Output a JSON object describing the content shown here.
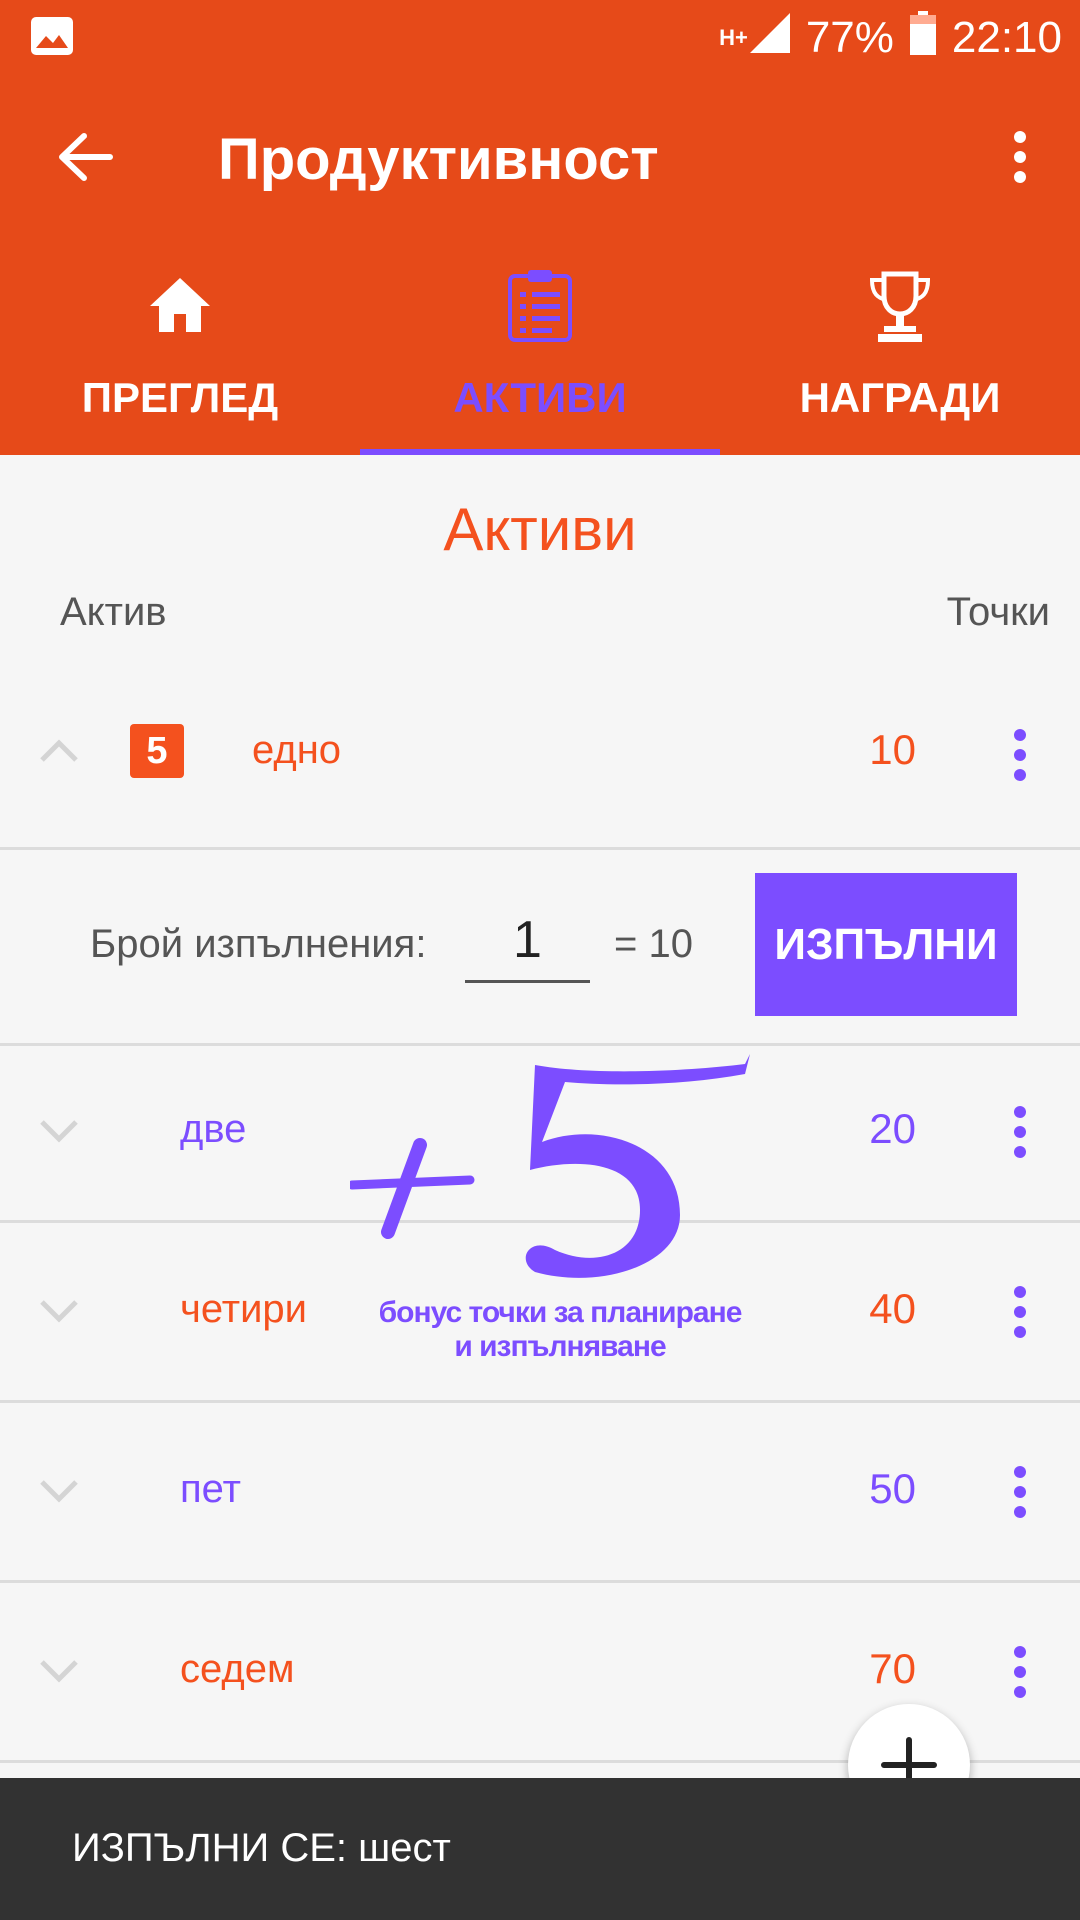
{
  "status_bar": {
    "network": "H+",
    "battery": "77%",
    "time": "22:10"
  },
  "toolbar": {
    "title": "Продуктивност"
  },
  "tabs": [
    {
      "label": "ПРЕГЛЕД",
      "icon": "home-icon"
    },
    {
      "label": "АКТИВИ",
      "icon": "clipboard-icon",
      "active": true
    },
    {
      "label": "НАГРАДИ",
      "icon": "trophy-icon"
    }
  ],
  "section": {
    "title": "Активи",
    "col_asset": "Актив",
    "col_points": "Точки"
  },
  "assets": [
    {
      "name": "едно",
      "points": "10",
      "badge": "5",
      "color": "#f4511e",
      "expanded": true
    },
    {
      "name": "две",
      "points": "20",
      "color": "#7c4dff"
    },
    {
      "name": "четири",
      "points": "40",
      "color": "#f4511e"
    },
    {
      "name": "пет",
      "points": "50",
      "color": "#7c4dff"
    },
    {
      "name": "седем",
      "points": "70",
      "color": "#f4511e"
    }
  ],
  "execution": {
    "label": "Брой изпълнения:",
    "count": "1",
    "total": "= 10",
    "button": "ИЗПЪЛНИ"
  },
  "bonus": {
    "line1": "бонус точки за планиране",
    "line2": "и изпълняване"
  },
  "snackbar": {
    "text": "ИЗПЪЛНИ СЕ: шест"
  },
  "colors": {
    "primary": "#e64a19",
    "accent": "#7c4dff",
    "orange_text": "#f4511e"
  }
}
